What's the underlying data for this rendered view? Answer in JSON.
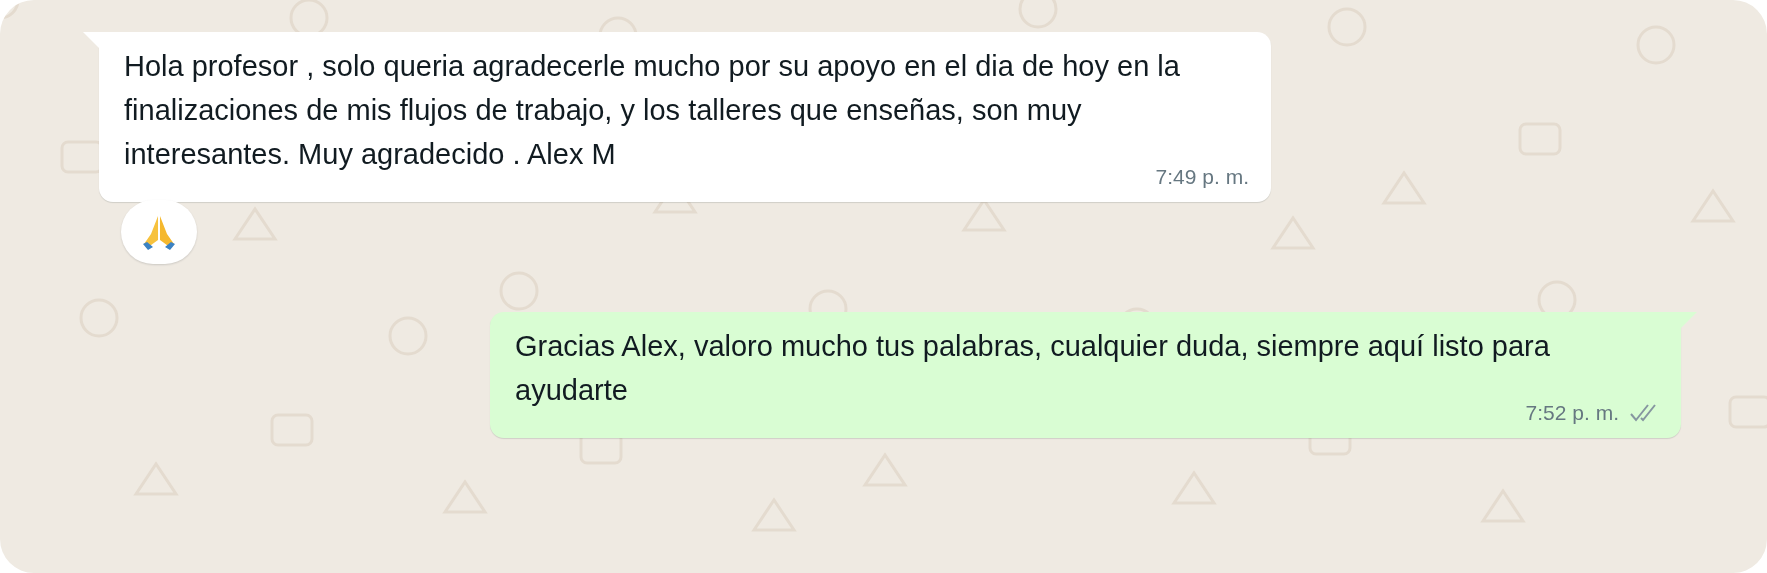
{
  "messages": [
    {
      "kind": "incoming",
      "text": "Hola profesor , solo queria agradecerle mucho por su apoyo en el dia de hoy en la finalizaciones de mis flujos de trabajo, y los talleres que enseñas, son muy interesantes. Muy agradecido . Alex M",
      "time": "7:49 p. m.",
      "reaction": {
        "kind": "pray"
      }
    },
    {
      "kind": "outgoing",
      "text": "Gracias Alex, valoro mucho tus palabras, cualquier duda, siempre aquí listo para ayudarte",
      "time": "7:52 p. m.",
      "read": false
    }
  ]
}
